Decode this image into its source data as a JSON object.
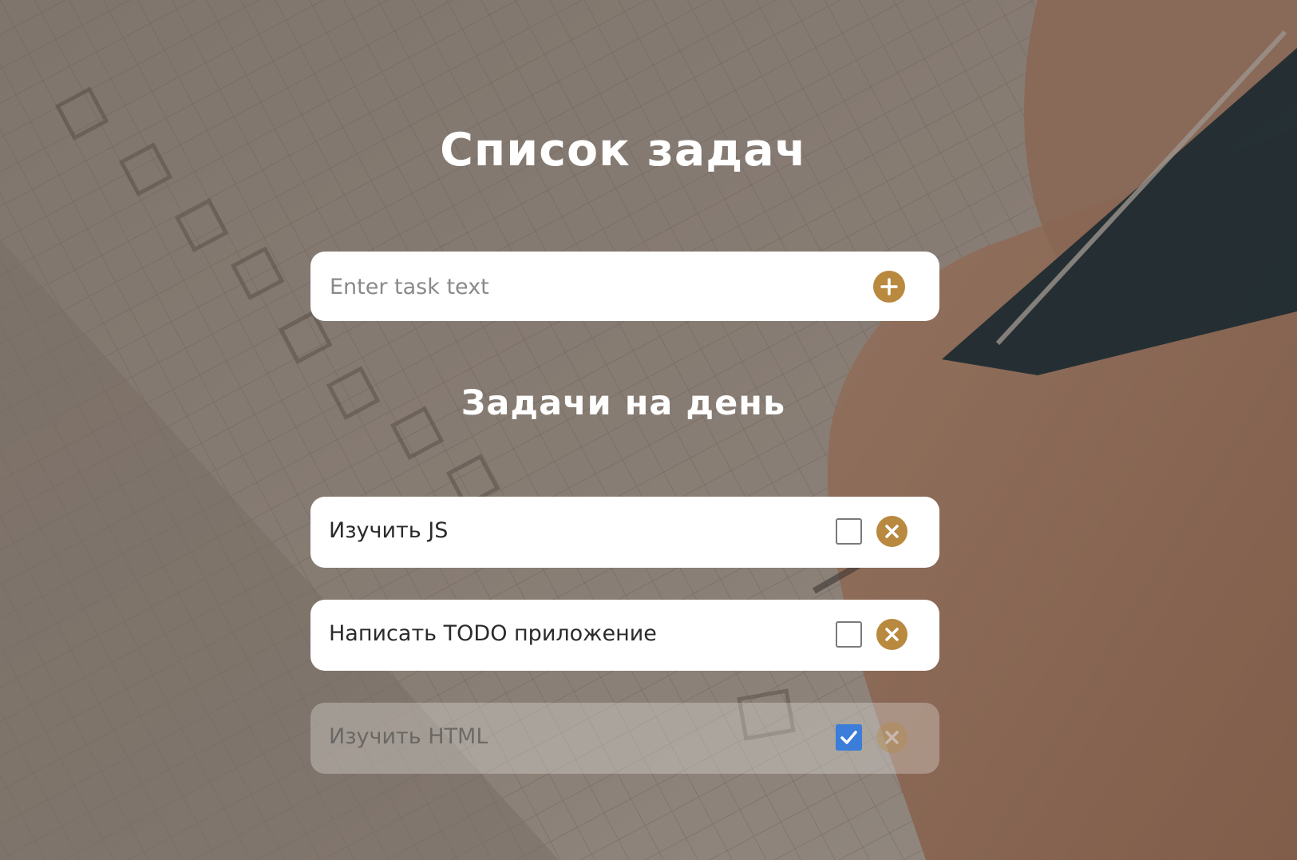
{
  "app": {
    "title": "Список задач",
    "subtitle": "Задачи на день"
  },
  "add_form": {
    "placeholder": "Enter task text",
    "value": "",
    "add_icon": "plus-circle-icon"
  },
  "tasks": [
    {
      "text": "Изучить JS",
      "done": false,
      "delete_icon": "close-circle-icon"
    },
    {
      "text": "Написать TODO приложение",
      "done": false,
      "delete_icon": "close-circle-icon"
    },
    {
      "text": "Изучить HTML",
      "done": true,
      "delete_icon": "close-circle-icon"
    }
  ],
  "colors": {
    "accent": "#b8893f",
    "checkbox_checked": "#3b7dd8",
    "card": "#ffffff",
    "heading": "#ffffff"
  }
}
